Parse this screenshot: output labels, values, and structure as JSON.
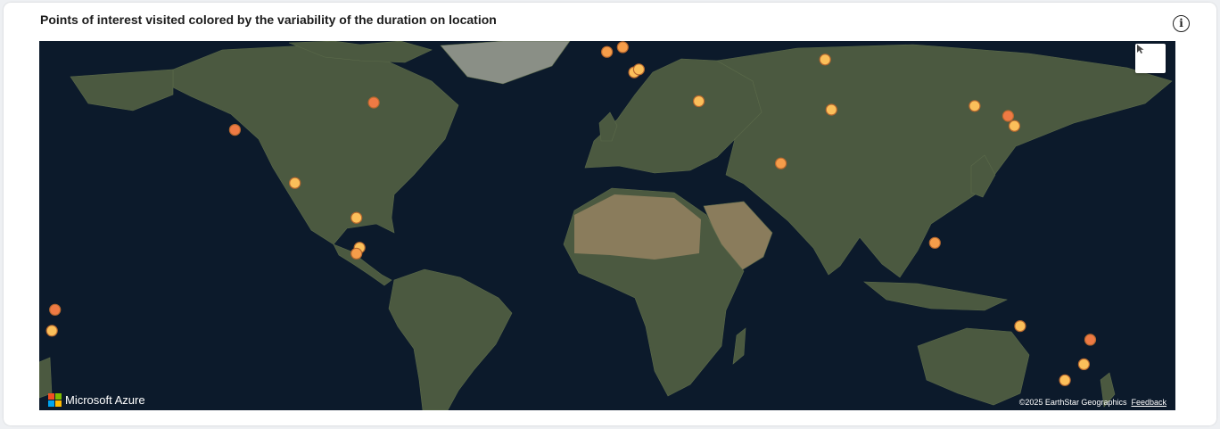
{
  "widget": {
    "title": "Points of interest visited colored by the variability of the duration on location",
    "info_symbol": "i"
  },
  "map": {
    "logo_text": "Microsoft Azure",
    "attribution": "©2025 EarthStar Geographics",
    "feedback_label": "Feedback",
    "colors": {
      "ocean": "#0c1a2b",
      "land": "#4d5a3f",
      "desert": "#8a7c5c",
      "ice": "#e8ebee",
      "marker_light": "#fbbf5a",
      "marker_medium": "#f59d4a",
      "marker_dark": "#ee7a44"
    },
    "icons": {
      "select": "cursor-arrow-icon",
      "logo": "microsoft-logo-icon"
    },
    "points": [
      {
        "lon": -42,
        "lat": 71,
        "level": "medium"
      },
      {
        "lon": -21,
        "lat": 64,
        "level": "medium"
      },
      {
        "lon": -20.5,
        "lat": 64.2,
        "level": "light"
      },
      {
        "lon": -0.1,
        "lat": 51.5,
        "level": "medium"
      },
      {
        "lon": 4.9,
        "lat": 52.4,
        "level": "medium"
      },
      {
        "lon": 8.5,
        "lat": 47.4,
        "level": "light"
      },
      {
        "lon": 10,
        "lat": 48,
        "level": "light"
      },
      {
        "lon": 10.5,
        "lat": 55.7,
        "level": "light"
      },
      {
        "lon": 29,
        "lat": 41,
        "level": "light"
      },
      {
        "lon": 69,
        "lat": 50,
        "level": "light"
      },
      {
        "lon": 71,
        "lat": 39,
        "level": "light"
      },
      {
        "lon": 55,
        "lat": 25,
        "level": "medium"
      },
      {
        "lon": 116.4,
        "lat": 39.9,
        "level": "light"
      },
      {
        "lon": 127,
        "lat": 37.5,
        "level": "dark"
      },
      {
        "lon": 129,
        "lat": 35,
        "level": "light"
      },
      {
        "lon": 103.8,
        "lat": 1.3,
        "level": "medium"
      },
      {
        "lon": -74,
        "lat": 40.7,
        "level": "dark"
      },
      {
        "lon": -118,
        "lat": 34,
        "level": "dark"
      },
      {
        "lon": -99,
        "lat": 19.4,
        "level": "light"
      },
      {
        "lon": -79.5,
        "lat": 9,
        "level": "light"
      },
      {
        "lon": -78.5,
        "lat": -0.2,
        "level": "light"
      },
      {
        "lon": -79.5,
        "lat": -2,
        "level": "medium"
      },
      {
        "lon": 130.8,
        "lat": -23.7,
        "level": "light"
      },
      {
        "lon": 153,
        "lat": -27.5,
        "level": "dark"
      },
      {
        "lon": 151,
        "lat": -34,
        "level": "light"
      },
      {
        "lon": 145,
        "lat": -38,
        "level": "light"
      },
      {
        "lon": -175,
        "lat": -19,
        "level": "dark"
      },
      {
        "lon": -176,
        "lat": -25,
        "level": "light"
      }
    ]
  }
}
